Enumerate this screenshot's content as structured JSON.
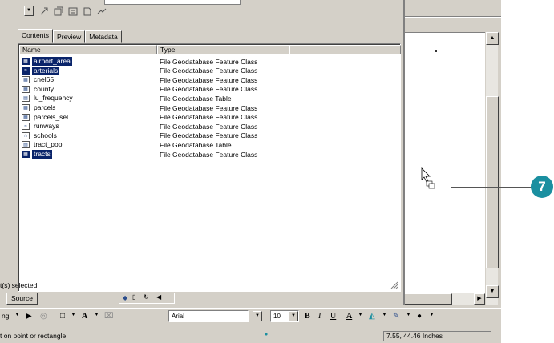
{
  "tabs": [
    "Contents",
    "Preview",
    "Metadata"
  ],
  "columns": {
    "name": "Name",
    "type": "Type"
  },
  "rows": [
    {
      "name": "airport_area",
      "type": "File Geodatabase Feature Class",
      "selected": true,
      "icon": "polygon-fc-icon"
    },
    {
      "name": "arterials",
      "type": "File Geodatabase Feature Class",
      "selected": true,
      "icon": "line-fc-icon"
    },
    {
      "name": "cnel65",
      "type": "File Geodatabase Feature Class",
      "selected": false,
      "icon": "polygon-fc-icon"
    },
    {
      "name": "county",
      "type": "File Geodatabase Feature Class",
      "selected": false,
      "icon": "polygon-fc-icon"
    },
    {
      "name": "lu_frequency",
      "type": "File Geodatabase Table",
      "selected": false,
      "icon": "table-icon"
    },
    {
      "name": "parcels",
      "type": "File Geodatabase Feature Class",
      "selected": false,
      "icon": "polygon-fc-icon"
    },
    {
      "name": "parcels_sel",
      "type": "File Geodatabase Feature Class",
      "selected": false,
      "icon": "polygon-fc-icon"
    },
    {
      "name": "runways",
      "type": "File Geodatabase Feature Class",
      "selected": false,
      "icon": "line-fc-icon"
    },
    {
      "name": "schools",
      "type": "File Geodatabase Feature Class",
      "selected": false,
      "icon": "point-fc-icon"
    },
    {
      "name": "tract_pop",
      "type": "File Geodatabase Table",
      "selected": false,
      "icon": "table-icon"
    },
    {
      "name": "tracts",
      "type": "File Geodatabase Feature Class",
      "selected": true,
      "icon": "polygon-fc-icon"
    }
  ],
  "status_text": "t(s) selected",
  "source_label": "Source",
  "font_name": "Arial",
  "font_size": "10",
  "status_message": "t on point or rectangle",
  "coordinates": "7.55, 44.46 Inches",
  "callout_number": "7",
  "colors": {
    "selection": "#0a246a",
    "callout": "#1a8fa0",
    "chrome": "#d4d0c8"
  }
}
